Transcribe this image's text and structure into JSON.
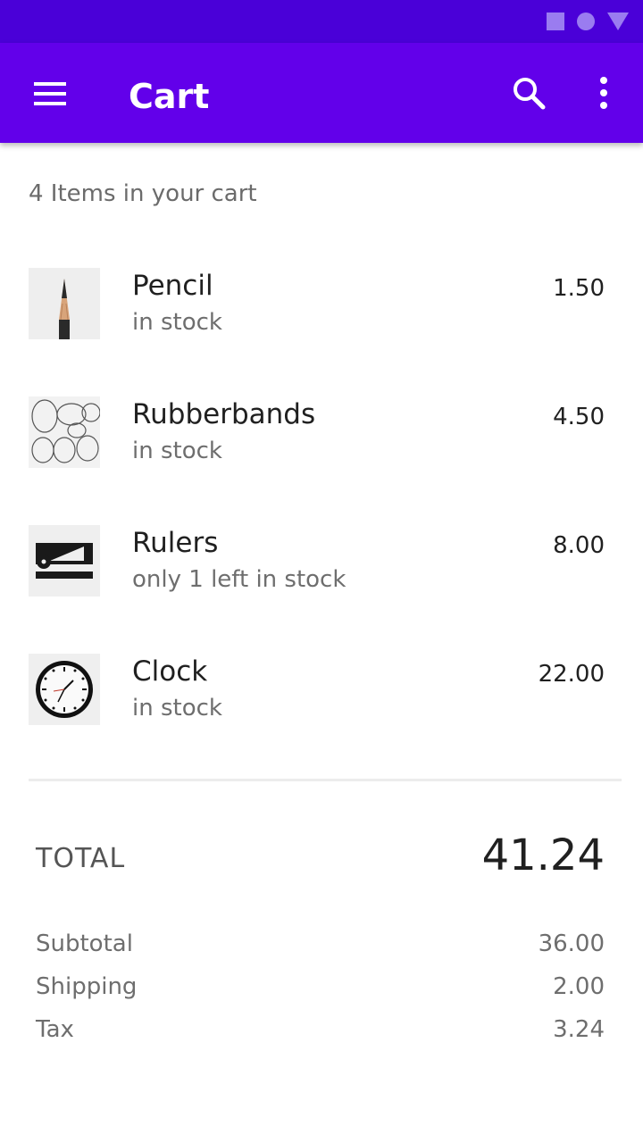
{
  "status_bar": {
    "icons": [
      "square-icon",
      "circle-icon",
      "triangle-icon"
    ],
    "color": "#4a00d8"
  },
  "app_bar": {
    "title": "Cart",
    "color": "#6200ea",
    "icons": [
      "menu-icon",
      "search-icon",
      "more-vert-icon"
    ]
  },
  "cart": {
    "count_text": "4 Items in your cart",
    "items": [
      {
        "name": "Pencil",
        "stock": "in stock",
        "price": "1.50",
        "thumbnail": "pencil-image"
      },
      {
        "name": "Rubberbands",
        "stock": "in stock",
        "price": "4.50",
        "thumbnail": "rubberbands-image"
      },
      {
        "name": "Rulers",
        "stock": "only 1 left in stock",
        "price": "8.00",
        "thumbnail": "rulers-image"
      },
      {
        "name": "Clock",
        "stock": "in stock",
        "price": "22.00",
        "thumbnail": "clock-image"
      }
    ]
  },
  "summary": {
    "total_label": "TOTAL",
    "total_value": "41.24",
    "rows": [
      {
        "label": "Subtotal",
        "value": "36.00"
      },
      {
        "label": "Shipping",
        "value": "2.00"
      },
      {
        "label": "Tax",
        "value": "3.24"
      }
    ]
  }
}
